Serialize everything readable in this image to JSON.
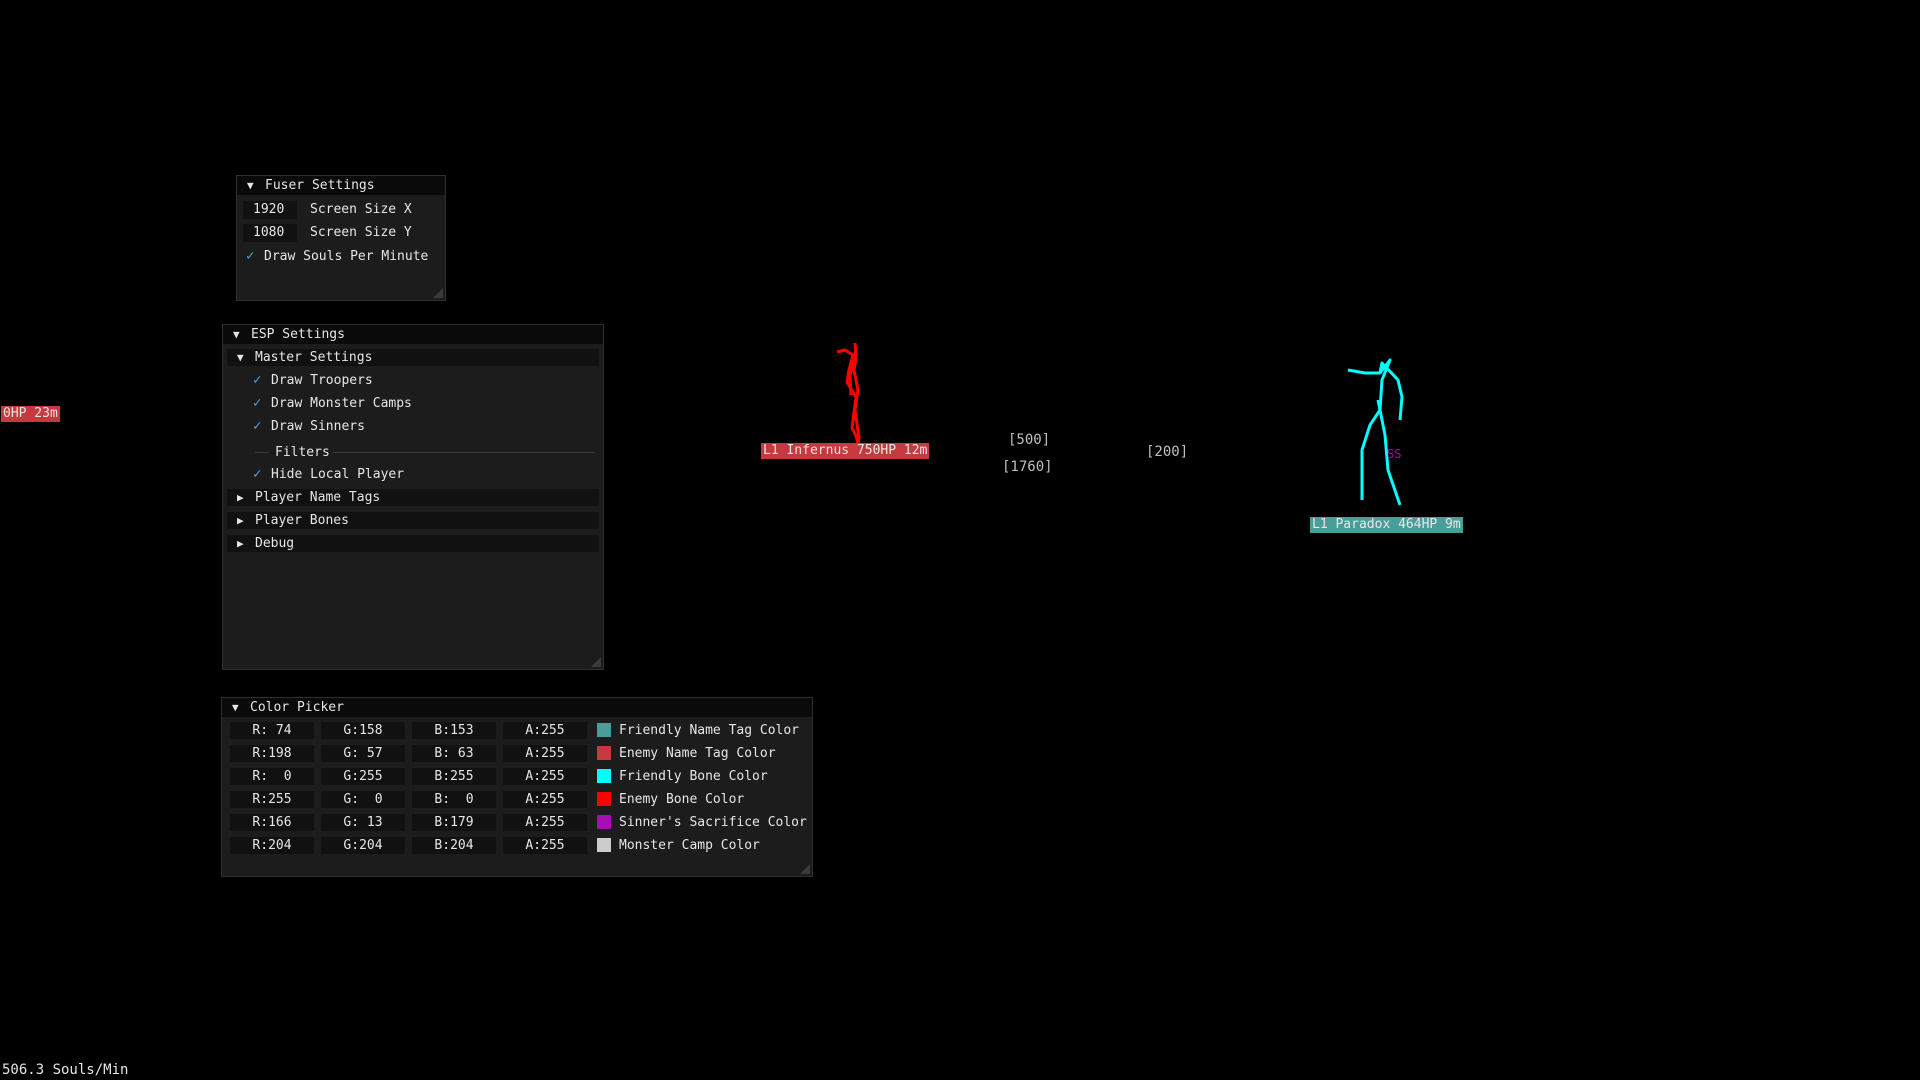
{
  "fuser": {
    "title": "Fuser Settings",
    "screen_x_value": "1920",
    "screen_x_label": "Screen Size X",
    "screen_y_value": "1080",
    "screen_y_label": "Screen Size Y",
    "draw_spm_label": "Draw Souls Per Minute"
  },
  "esp": {
    "title": "ESP Settings",
    "master_title": "Master Settings",
    "draw_troopers": "Draw Troopers",
    "draw_monster_camps": "Draw Monster Camps",
    "draw_sinners": "Draw Sinners",
    "filters_label": "Filters",
    "hide_local_player": "Hide Local Player",
    "player_name_tags": "Player Name Tags",
    "player_bones": "Player Bones",
    "debug": "Debug"
  },
  "color_picker": {
    "title": "Color Picker",
    "rows": [
      {
        "r": "R: 74",
        "g": "G:158",
        "b": "B:153",
        "a": "A:255",
        "label": "Friendly Name Tag Color",
        "color": "#4a9e99"
      },
      {
        "r": "R:198",
        "g": "G: 57",
        "b": "B: 63",
        "a": "A:255",
        "label": "Enemy Name Tag Color",
        "color": "#c6393f"
      },
      {
        "r": "R:  0",
        "g": "G:255",
        "b": "B:255",
        "a": "A:255",
        "label": "Friendly Bone Color",
        "color": "#00ffff"
      },
      {
        "r": "R:255",
        "g": "G:  0",
        "b": "B:  0",
        "a": "A:255",
        "label": "Enemy Bone Color",
        "color": "#ff0000"
      },
      {
        "r": "R:166",
        "g": "G: 13",
        "b": "B:179",
        "a": "A:255",
        "label": "Sinner's Sacrifice Color",
        "color": "#a60db3"
      },
      {
        "r": "R:204",
        "g": "G:204",
        "b": "B:204",
        "a": "A:255",
        "label": "Monster Camp Color",
        "color": "#cccccc"
      }
    ]
  },
  "overlay": {
    "left_tag": "0HP 23m",
    "enemy_tag": "L1 Infernus 750HP 12m",
    "friendly_tag": "L1 Paradox 464HP 9m",
    "camp_500": "[500]",
    "camp_1760": "[1760]",
    "camp_200": "[200]",
    "ss_label": "SS",
    "souls_per_min": "506.3 Souls/Min"
  },
  "colors": {
    "friendly_tag": "#4a9e99",
    "enemy_tag": "#c6393f",
    "friendly_bone": "#00ffff",
    "enemy_bone": "#ff0000",
    "sinner": "#a60db3",
    "check": "#4aa3df"
  }
}
